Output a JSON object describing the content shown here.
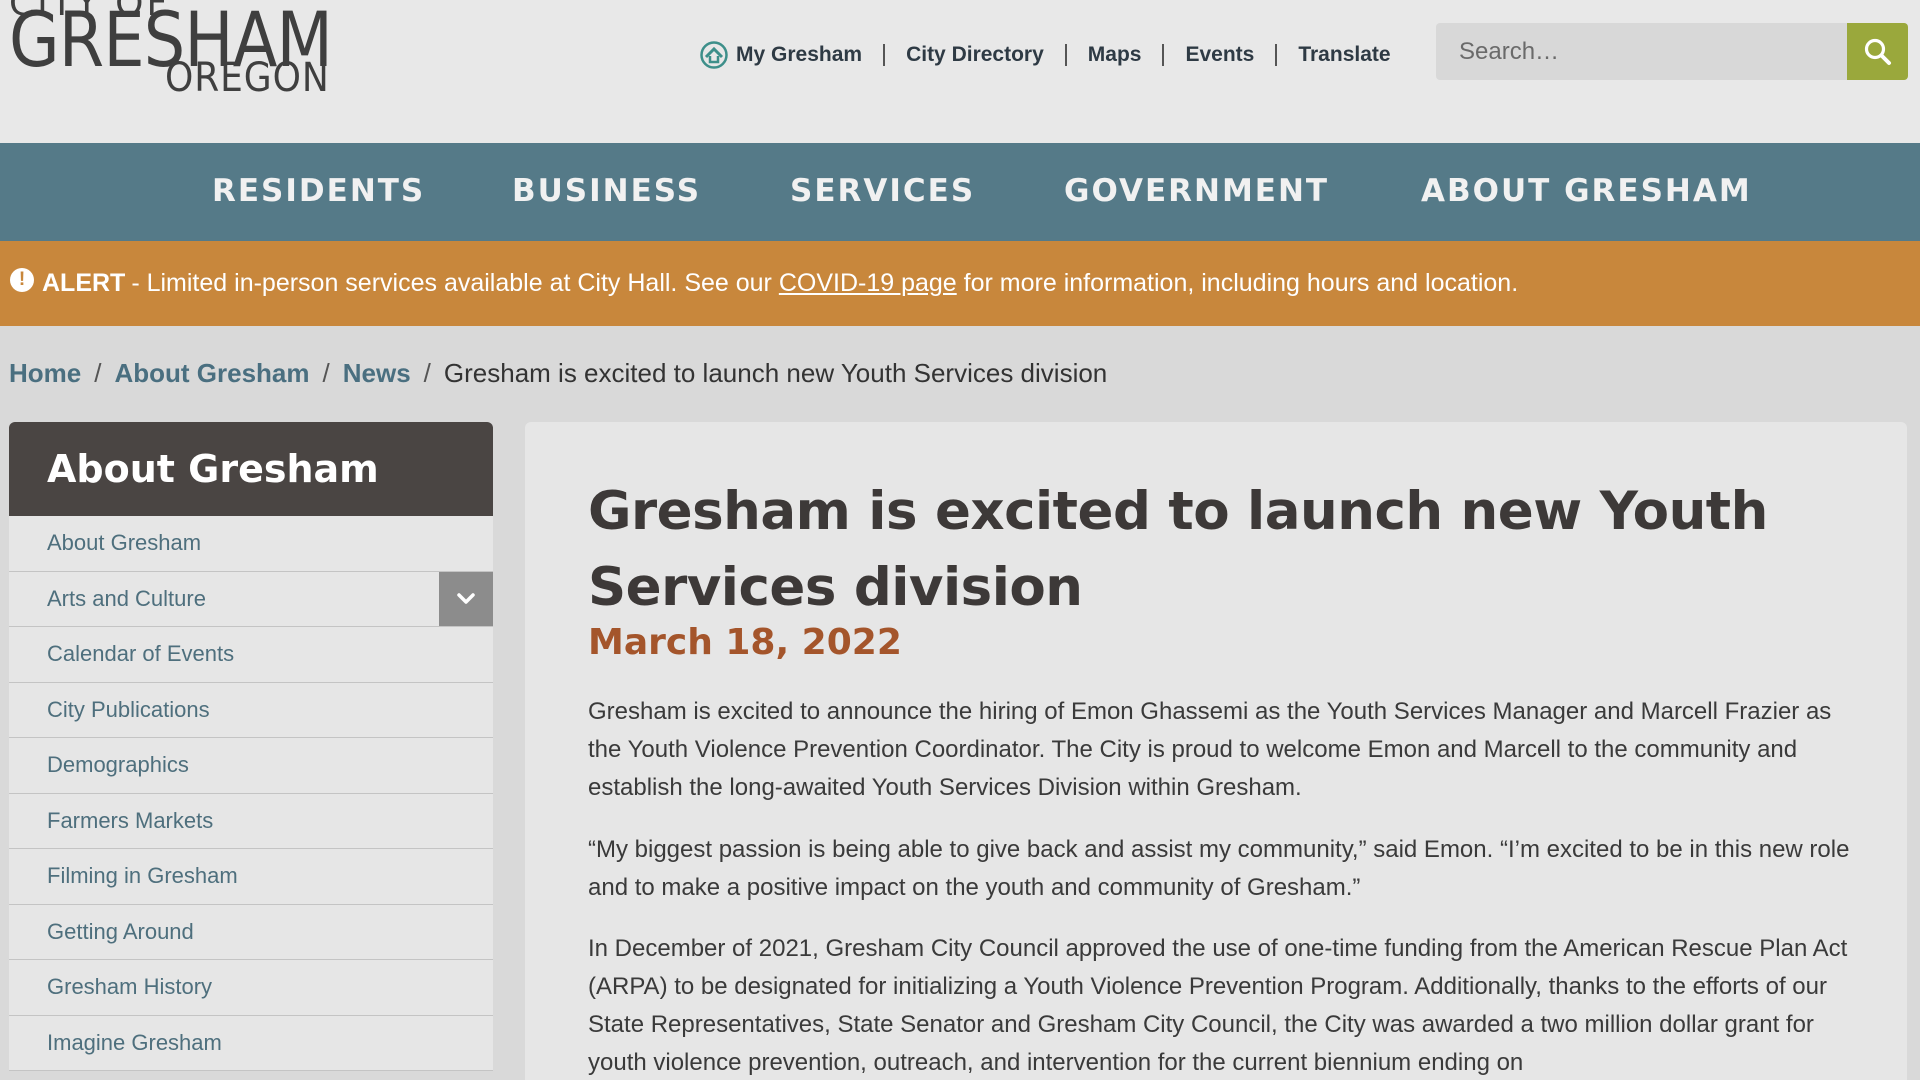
{
  "logo": {
    "line1": "CITY OF",
    "line2": "GRESHAM",
    "line3": "OREGON"
  },
  "utility_nav": [
    {
      "label": "My Gresham",
      "icon": "house-icon"
    },
    {
      "label": "City Directory"
    },
    {
      "label": "Maps"
    },
    {
      "label": "Events"
    },
    {
      "label": "Translate"
    }
  ],
  "search": {
    "placeholder": "Search…",
    "button_icon": "search-icon",
    "button_color": "#9aa83c"
  },
  "main_nav": [
    "RESIDENTS",
    "BUSINESS",
    "SERVICES",
    "GOVERNMENT",
    "ABOUT GRESHAM"
  ],
  "alert": {
    "label": "ALERT",
    "text_before": "- Limited in-person services available at City Hall. See our",
    "link": "COVID-19 page",
    "text_after": "for more information, including hours and location.",
    "color": "#c8873c"
  },
  "breadcrumb": {
    "items": [
      "Home",
      "About Gresham",
      "News"
    ],
    "current": "Gresham is excited to launch new Youth Services division"
  },
  "sidebar": {
    "title": "About Gresham",
    "items": [
      "About Gresham",
      "Arts and Culture",
      "Calendar of Events",
      "City Publications",
      "Demographics",
      "Farmers Markets",
      "Filming in Gresham",
      "Getting Around",
      "Gresham History",
      "Imagine Gresham"
    ]
  },
  "article": {
    "title": "Gresham is excited to launch new Youth Services division",
    "date": "March 18, 2022",
    "paragraphs": [
      "Gresham is excited to announce the hiring of Emon Ghassemi as the Youth Services Manager and Marcell Frazier as the Youth Violence Prevention Coordinator. The City is proud to welcome Emon and Marcell to the community and establish the long-awaited Youth Services Division within Gresham.",
      "“My biggest passion is being able to give back and assist my community,” said Emon. “I’m excited to be in this new role and to make a positive impact on the youth and community of Gresham.”",
      "In December of 2021, Gresham City Council approved the use of one-time funding from the American Rescue Plan Act (ARPA) to be designated for initializing a Youth Violence Prevention Program. Additionally, thanks to the efforts of our State Representatives, State Senator and Gresham City Council, the City was awarded a two million dollar grant for youth violence prevention, outreach, and intervention for the current biennium ending on"
    ]
  }
}
